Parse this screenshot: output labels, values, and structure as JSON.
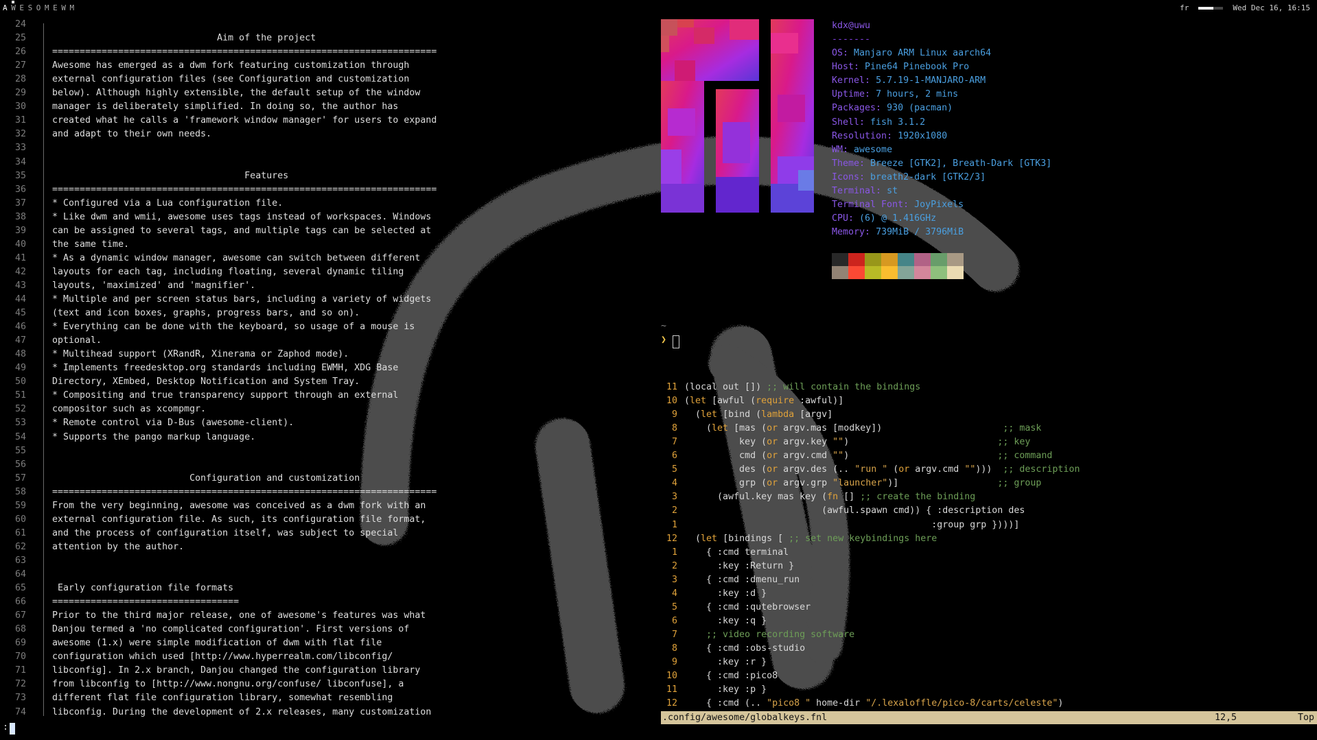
{
  "topbar": {
    "tags": [
      "A",
      "W",
      "E",
      "S",
      "O",
      "M",
      "E",
      "W",
      "M"
    ],
    "active_tag_index": 0,
    "keyboard_layout": "fr",
    "volume_level": 0.6,
    "clock": "Wed Dec 16, 16:15"
  },
  "left_pane": {
    "lines": [
      {
        "n": "24",
        "t": ""
      },
      {
        "n": "25",
        "t": "                              Aim of the project"
      },
      {
        "n": "26",
        "t": "======================================================================"
      },
      {
        "n": "27",
        "t": "Awesome has emerged as a dwm fork featuring customization through"
      },
      {
        "n": "28",
        "t": "external configuration files (see Configuration and customization"
      },
      {
        "n": "29",
        "t": "below). Although highly extensible, the default setup of the window"
      },
      {
        "n": "30",
        "t": "manager is deliberately simplified. In doing so, the author has"
      },
      {
        "n": "31",
        "t": "created what he calls a 'framework window manager' for users to expand"
      },
      {
        "n": "32",
        "t": "and adapt to their own needs."
      },
      {
        "n": "33",
        "t": ""
      },
      {
        "n": "34",
        "t": ""
      },
      {
        "n": "35",
        "t": "                                   Features"
      },
      {
        "n": "36",
        "t": "======================================================================"
      },
      {
        "n": "37",
        "t": "* Configured via a Lua configuration file."
      },
      {
        "n": "38",
        "t": "* Like dwm and wmii, awesome uses tags instead of workspaces. Windows"
      },
      {
        "n": "39",
        "t": "can be assigned to several tags, and multiple tags can be selected at"
      },
      {
        "n": "40",
        "t": "the same time."
      },
      {
        "n": "41",
        "t": "* As a dynamic window manager, awesome can switch between different"
      },
      {
        "n": "42",
        "t": "layouts for each tag, including floating, several dynamic tiling"
      },
      {
        "n": "43",
        "t": "layouts, 'maximized' and 'magnifier'."
      },
      {
        "n": "44",
        "t": "* Multiple and per screen status bars, including a variety of widgets"
      },
      {
        "n": "45",
        "t": "(text and icon boxes, graphs, progress bars, and so on)."
      },
      {
        "n": "46",
        "t": "* Everything can be done with the keyboard, so usage of a mouse is"
      },
      {
        "n": "47",
        "t": "optional."
      },
      {
        "n": "48",
        "t": "* Multihead support (XRandR, Xinerama or Zaphod mode)."
      },
      {
        "n": "49",
        "t": "* Implements freedesktop.org standards including EWMH, XDG Base"
      },
      {
        "n": "50",
        "t": "Directory, XEmbed, Desktop Notification and System Tray."
      },
      {
        "n": "51",
        "t": "* Compositing and true transparency support through an external"
      },
      {
        "n": "52",
        "t": "compositor such as xcompmgr."
      },
      {
        "n": "53",
        "t": "* Remote control via D-Bus (awesome-client)."
      },
      {
        "n": "54",
        "t": "* Supports the pango markup language."
      },
      {
        "n": "55",
        "t": ""
      },
      {
        "n": "56",
        "t": ""
      },
      {
        "n": "57",
        "t": "                         Configuration and customization"
      },
      {
        "n": "58",
        "t": "======================================================================"
      },
      {
        "n": "59",
        "t": "From the very beginning, awesome was conceived as a dwm fork with an"
      },
      {
        "n": "60",
        "t": "external configuration file. As such, its configuration file format,"
      },
      {
        "n": "61",
        "t": "and the process of configuration itself, was subject to special"
      },
      {
        "n": "62",
        "t": "attention by the author."
      },
      {
        "n": "63",
        "t": ""
      },
      {
        "n": "64",
        "t": ""
      },
      {
        "n": "65",
        "t": " Early configuration file formats"
      },
      {
        "n": "66",
        "t": "=================================="
      },
      {
        "n": "67",
        "t": "Prior to the third major release, one of awesome's features was what"
      },
      {
        "n": "68",
        "t": "Danjou termed a 'no complicated configuration'. First versions of"
      },
      {
        "n": "69",
        "t": "awesome (1.x) were simple modification of dwm with flat file"
      },
      {
        "n": "70",
        "t": "configuration which used [http://www.hyperrealm.com/libconfig/"
      },
      {
        "n": "71",
        "t": "libconfig]. In 2.x branch, Danjou changed the configuration library"
      },
      {
        "n": "72",
        "t": "from libconfig to [http://www.nongnu.org/confuse/ libconfuse], a"
      },
      {
        "n": "73",
        "t": "different flat file configuration library, somewhat resembling"
      },
      {
        "n": "74",
        "t": "libconfig. During the development of 2.x releases, many customization"
      }
    ]
  },
  "neofetch": {
    "user_host": "kdx@uwu",
    "separator": "-------",
    "fields": [
      {
        "k": "OS",
        "v": "Manjaro ARM Linux aarch64"
      },
      {
        "k": "Host",
        "v": "Pine64 Pinebook Pro"
      },
      {
        "k": "Kernel",
        "v": "5.7.19-1-MANJARO-ARM"
      },
      {
        "k": "Uptime",
        "v": "7 hours, 2 mins"
      },
      {
        "k": "Packages",
        "v": "930 (pacman)"
      },
      {
        "k": "Shell",
        "v": "fish 3.1.2"
      },
      {
        "k": "Resolution",
        "v": "1920x1080"
      },
      {
        "k": "WM",
        "v": "awesome"
      },
      {
        "k": "Theme",
        "v": "Breeze [GTK2], Breath-Dark [GTK3]"
      },
      {
        "k": "Icons",
        "v": "breath2-dark [GTK2/3]"
      },
      {
        "k": "Terminal",
        "v": "st"
      },
      {
        "k": "Terminal Font",
        "v": "JoyPixels"
      },
      {
        "k": "CPU",
        "v": "(6) @ 1.416GHz"
      },
      {
        "k": "Memory",
        "v": "739MiB / 3796MiB"
      }
    ],
    "palette_top": [
      "#282828",
      "#cc241d",
      "#98971a",
      "#d79921",
      "#458588",
      "#b16286",
      "#689d6a",
      "#a89984"
    ],
    "palette_bottom": [
      "#928374",
      "#fb4934",
      "#b8bb26",
      "#fabd2f",
      "#83a598",
      "#d3869b",
      "#8ec07c",
      "#ebdbb2"
    ]
  },
  "prompt": {
    "cwd": "~",
    "symbol": "❯"
  },
  "code": {
    "lines": [
      {
        "n": "11",
        "segs": [
          [
            "p",
            "(local out []) "
          ],
          [
            "c",
            ";; will contain the bindings"
          ]
        ]
      },
      {
        "n": "10",
        "segs": [
          [
            "p",
            "("
          ],
          [
            "k",
            "let"
          ],
          [
            "p",
            " [awful ("
          ],
          [
            "k",
            "require"
          ],
          [
            "p",
            " :awful)]"
          ]
        ]
      },
      {
        "n": "9",
        "segs": [
          [
            "p",
            "  ("
          ],
          [
            "k",
            "let"
          ],
          [
            "p",
            " [bind ("
          ],
          [
            "k",
            "lambda"
          ],
          [
            "p",
            " [argv]"
          ]
        ]
      },
      {
        "n": "8",
        "segs": [
          [
            "p",
            "    ("
          ],
          [
            "k",
            "let"
          ],
          [
            "p",
            " [mas ("
          ],
          [
            "k",
            "or"
          ],
          [
            "p",
            " argv.mas [modkey])                      "
          ],
          [
            "c",
            ";; mask"
          ]
        ]
      },
      {
        "n": "7",
        "segs": [
          [
            "p",
            "          key ("
          ],
          [
            "k",
            "or"
          ],
          [
            "p",
            " argv.key "
          ],
          [
            "s",
            "\"\""
          ],
          [
            "p",
            ")                           "
          ],
          [
            "c",
            ";; key"
          ]
        ]
      },
      {
        "n": "6",
        "segs": [
          [
            "p",
            "          cmd ("
          ],
          [
            "k",
            "or"
          ],
          [
            "p",
            " argv.cmd "
          ],
          [
            "s",
            "\"\""
          ],
          [
            "p",
            ")                           "
          ],
          [
            "c",
            ";; command"
          ]
        ]
      },
      {
        "n": "5",
        "segs": [
          [
            "p",
            "          des ("
          ],
          [
            "k",
            "or"
          ],
          [
            "p",
            " argv.des (.. "
          ],
          [
            "s",
            "\"run \""
          ],
          [
            "p",
            " ("
          ],
          [
            "k",
            "or"
          ],
          [
            "p",
            " argv.cmd "
          ],
          [
            "s",
            "\"\""
          ],
          [
            "p",
            ")))  "
          ],
          [
            "c",
            ";; description"
          ]
        ]
      },
      {
        "n": "4",
        "segs": [
          [
            "p",
            "          grp ("
          ],
          [
            "k",
            "or"
          ],
          [
            "p",
            " argv.grp "
          ],
          [
            "s",
            "\"launcher\""
          ],
          [
            "p",
            ")]                  "
          ],
          [
            "c",
            ";; group"
          ]
        ]
      },
      {
        "n": "3",
        "segs": [
          [
            "p",
            "      (awful.key mas key ("
          ],
          [
            "k",
            "fn"
          ],
          [
            "p",
            " [] "
          ],
          [
            "c",
            ";; create the binding"
          ]
        ]
      },
      {
        "n": "2",
        "segs": [
          [
            "p",
            "                         (awful.spawn cmd)) { :description des"
          ]
        ]
      },
      {
        "n": "1",
        "segs": [
          [
            "p",
            "                                             :group grp })))]"
          ]
        ]
      },
      {
        "n": "12",
        "segs": [
          [
            "p",
            "  ("
          ],
          [
            "k",
            "let"
          ],
          [
            "p",
            " [bindings [ "
          ],
          [
            "c",
            ";; set new keybindings here"
          ]
        ]
      },
      {
        "n": "1",
        "segs": [
          [
            "p",
            "    { :cmd terminal"
          ]
        ]
      },
      {
        "n": "2",
        "segs": [
          [
            "p",
            "      :key :Return }"
          ]
        ]
      },
      {
        "n": "3",
        "segs": [
          [
            "p",
            "    { :cmd :dmenu_run"
          ]
        ]
      },
      {
        "n": "4",
        "segs": [
          [
            "p",
            "      :key :d }"
          ]
        ]
      },
      {
        "n": "5",
        "segs": [
          [
            "p",
            "    { :cmd :qutebrowser"
          ]
        ]
      },
      {
        "n": "6",
        "segs": [
          [
            "p",
            "      :key :q }"
          ]
        ]
      },
      {
        "n": "7",
        "segs": [
          [
            "c",
            "    ;; video recording software"
          ]
        ]
      },
      {
        "n": "8",
        "segs": [
          [
            "p",
            "    { :cmd :obs-studio"
          ]
        ]
      },
      {
        "n": "9",
        "segs": [
          [
            "p",
            "      :key :r }"
          ]
        ]
      },
      {
        "n": "10",
        "segs": [
          [
            "p",
            "    { :cmd :pico8"
          ]
        ]
      },
      {
        "n": "11",
        "segs": [
          [
            "p",
            "      :key :p }"
          ]
        ]
      },
      {
        "n": "12",
        "segs": [
          [
            "p",
            "    { :cmd (.. "
          ],
          [
            "s",
            "\"pico8 \""
          ],
          [
            "p",
            " home-dir "
          ],
          [
            "s",
            "\"/.lexaloffle/pico-8/carts/celeste\""
          ],
          [
            "p",
            ")"
          ]
        ]
      }
    ]
  },
  "statusline": {
    "file": ".config/awesome/globalkeys.fnl",
    "position": "12,5",
    "scroll": "Top"
  },
  "cmdline": {
    "text": ":"
  }
}
